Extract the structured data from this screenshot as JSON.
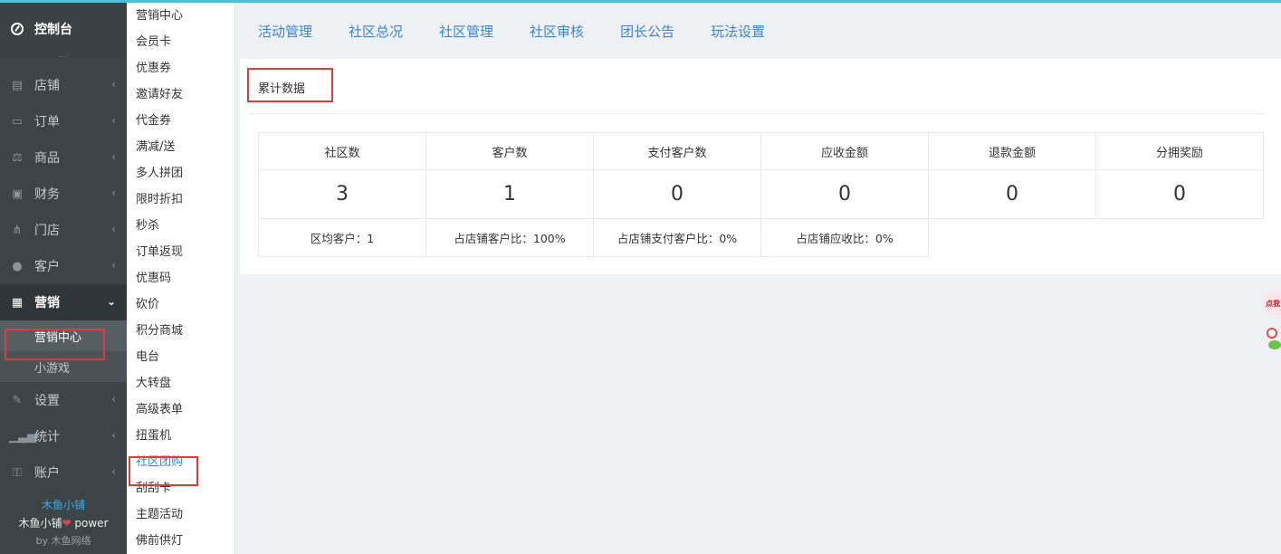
{
  "sidebar": {
    "title": "控制台",
    "items": [
      {
        "label": "店铺",
        "icon": "store-icon"
      },
      {
        "label": "订单",
        "icon": "order-icon"
      },
      {
        "label": "商品",
        "icon": "scale-icon"
      },
      {
        "label": "财务",
        "icon": "money-icon"
      },
      {
        "label": "门店",
        "icon": "branches-icon"
      },
      {
        "label": "客户",
        "icon": "users-icon"
      },
      {
        "label": "营销",
        "icon": "gift-icon"
      },
      {
        "label": "设置",
        "icon": "wrench-icon"
      },
      {
        "label": "统计",
        "icon": "bar-chart-icon"
      },
      {
        "label": "账户",
        "icon": "key-icon"
      }
    ],
    "marketing_sub": [
      "营销中心",
      "小游戏"
    ],
    "footer": {
      "brand": "木鱼小铺",
      "power_left": "木鱼小铺",
      "power_right": "power",
      "by": "by 木鱼网络"
    }
  },
  "submenu": [
    "营销中心",
    "会员卡",
    "优惠券",
    "邀请好友",
    "代金券",
    "满减/送",
    "多人拼团",
    "限时折扣",
    "秒杀",
    "订单返现",
    "优惠码",
    "砍价",
    "积分商城",
    "电台",
    "大转盘",
    "高级表单",
    "扭蛋机",
    "社区团购",
    "刮刮卡",
    "主题活动",
    "佛前供灯"
  ],
  "tabs": [
    "活动管理",
    "社区总况",
    "社区管理",
    "社区审核",
    "团长公告",
    "玩法设置"
  ],
  "panel": {
    "title": "累计数据",
    "headers": [
      "社区数",
      "客户数",
      "支付客户数",
      "应收金额",
      "退款金额",
      "分拥奖励"
    ],
    "values": [
      "3",
      "1",
      "0",
      "0",
      "0",
      "0"
    ],
    "ratios": [
      "区均客户：1",
      "占店铺客户比：100%",
      "占店铺支付客户比：0%",
      "占店铺应收比：0%"
    ]
  },
  "float": {
    "text": "点我"
  }
}
